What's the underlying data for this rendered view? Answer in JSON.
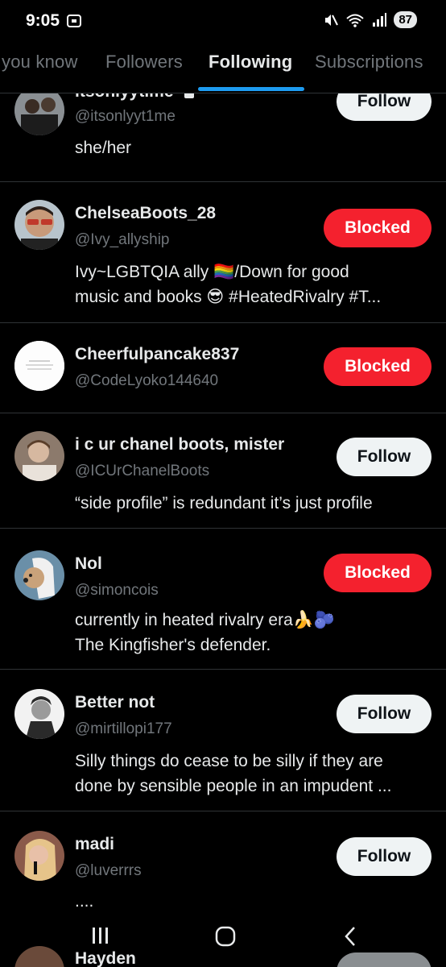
{
  "status_bar": {
    "time": "9:05",
    "battery": "87",
    "icons": [
      "screen-record-icon",
      "mute-icon",
      "wifi-icon",
      "signal-icon"
    ]
  },
  "tabs": [
    {
      "label": "you know",
      "active": false
    },
    {
      "label": "Followers",
      "active": false
    },
    {
      "label": "Following",
      "active": true
    },
    {
      "label": "Subscriptions",
      "active": false
    }
  ],
  "users": [
    {
      "name": "itsonlyytime",
      "handle": "@itsonlyyt1me",
      "bio": "she/her",
      "button": "Follow",
      "locked": true
    },
    {
      "name": "ChelseaBoots_28",
      "handle": "@Ivy_allyship",
      "bio_line1": "Ivy~LGBTQIA ally 🏳️‍🌈/Down for good",
      "bio_line2": "music and books 😎 #HeatedRivalry #T...",
      "button": "Blocked"
    },
    {
      "name": "Cheerfulpancake837",
      "handle": "@CodeLyoko144640",
      "bio": "",
      "button": "Blocked"
    },
    {
      "name": "i c ur chanel boots, mister",
      "handle": "@ICUrChanelBoots",
      "bio": "“side profile” is redundant it’s just profile",
      "button": "Follow"
    },
    {
      "name": "Nol",
      "handle": "@simoncois",
      "bio_line1": "currently in heated rivalry era🍌🫐",
      "bio_line2": "The Kingfisher's defender.",
      "button": "Blocked"
    },
    {
      "name": "Better not",
      "handle": "@mirtillopi177",
      "bio_line1": "Silly things do cease to be silly if they are",
      "bio_line2": "done by sensible people in an impudent ...",
      "button": "Follow"
    },
    {
      "name": "madi",
      "handle": "@luverrrs",
      "bio": "....",
      "button": "Follow"
    },
    {
      "name": "Hayden",
      "handle": "",
      "bio": "",
      "button": ""
    }
  ],
  "colors": {
    "accent": "#1d9bf0",
    "blocked": "#f4212e",
    "follow_bg": "#eff3f4",
    "secondary_text": "#71767b",
    "divider": "#2f3336"
  },
  "nav": [
    "recent-apps-icon",
    "home-icon",
    "back-icon"
  ]
}
